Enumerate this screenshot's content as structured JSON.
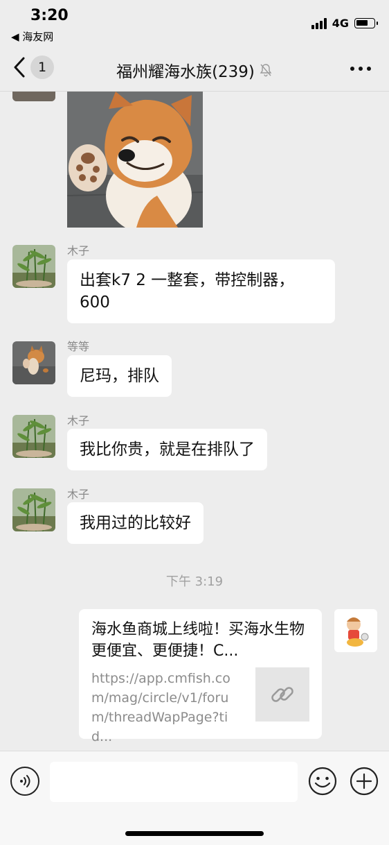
{
  "status_bar": {
    "time": "3:20",
    "back_app": "◀ 海友网",
    "network": "4G",
    "battery_level": 0.7
  },
  "nav": {
    "unread_count": "1",
    "title": "福州耀海水族(239)"
  },
  "messages": [
    {
      "sender": "木子",
      "text": "出套k7  2  一整套，带控制器，600"
    },
    {
      "sender": "等等",
      "text": "尼玛，排队"
    },
    {
      "sender": "木子",
      "text": "我比你贵，就是在排队了"
    },
    {
      "sender": "木子",
      "text": "我用过的比较好"
    }
  ],
  "timestamp": "下午 3:19",
  "link_share": {
    "title": "海水鱼商城上线啦！买海水生物更便宜、更便捷！C...",
    "url": "https://app.cmfish.com/mag/circle/v1/forum/threadWapPage?tid..."
  },
  "input_bar": {
    "placeholder": ""
  },
  "icons": {
    "back": "chevron-left-icon",
    "mute": "bell-off-icon",
    "more": "more-icon",
    "voice": "voice-icon",
    "emoji": "emoji-icon",
    "plus": "plus-icon",
    "link": "link-icon"
  }
}
